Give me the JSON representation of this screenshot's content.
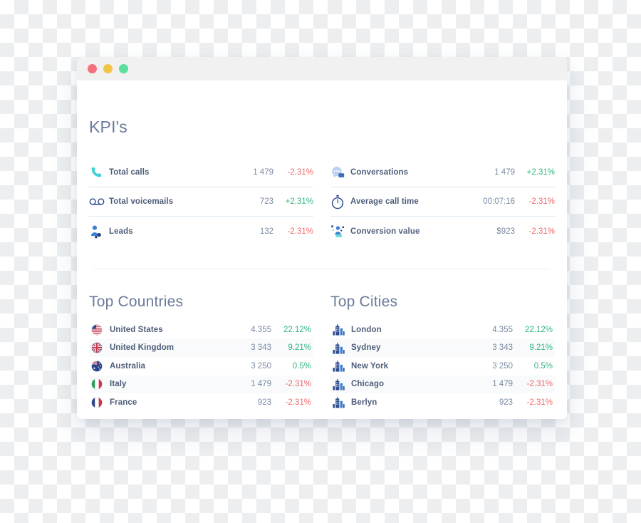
{
  "window": {
    "traffic_lights": [
      {
        "name": "close",
        "color": "#f4707f"
      },
      {
        "name": "minimize",
        "color": "#f3c445"
      },
      {
        "name": "maximize",
        "color": "#5ae09a"
      }
    ]
  },
  "header": {
    "title": "KPI's"
  },
  "kpis": {
    "left": [
      {
        "icon": "phone-icon",
        "label": "Total calls",
        "value": "1 479",
        "delta": "-2.31%",
        "trend": "down"
      },
      {
        "icon": "voicemail-icon",
        "label": "Total voicemails",
        "value": "723",
        "delta": "+2.31%",
        "trend": "up"
      },
      {
        "icon": "leads-icon",
        "label": "Leads",
        "value": "132",
        "delta": "-2.31%",
        "trend": "down"
      }
    ],
    "right": [
      {
        "icon": "chat-bubble-icon",
        "label": "Conversations",
        "value": "1 479",
        "delta": "+2.31%",
        "trend": "up"
      },
      {
        "icon": "stopwatch-icon",
        "label": "Average call time",
        "value": "00:07:16",
        "delta": "-2.31%",
        "trend": "down"
      },
      {
        "icon": "conversion-icon",
        "label": "Conversion value",
        "value": "$923",
        "delta": "-2.31%",
        "trend": "down"
      }
    ]
  },
  "top_countries": {
    "title": "Top Countries",
    "rows": [
      {
        "icon": "flag-us-icon",
        "label": "United States",
        "value": "4.355",
        "delta": "22.12%",
        "trend": "up"
      },
      {
        "icon": "flag-gb-icon",
        "label": "United Kingdom",
        "value": "3 343",
        "delta": "9.21%",
        "trend": "up"
      },
      {
        "icon": "flag-au-icon",
        "label": "Australia",
        "value": "3 250",
        "delta": "0.5%",
        "trend": "up"
      },
      {
        "icon": "flag-it-icon",
        "label": "Italy",
        "value": "1 479",
        "delta": "-2.31%",
        "trend": "down"
      },
      {
        "icon": "flag-fr-icon",
        "label": "France",
        "value": "923",
        "delta": "-2.31%",
        "trend": "down"
      }
    ]
  },
  "top_cities": {
    "title": "Top Cities",
    "rows": [
      {
        "icon": "city-icon",
        "label": "London",
        "value": "4.355",
        "delta": "22.12%",
        "trend": "up"
      },
      {
        "icon": "city-icon",
        "label": "Sydney",
        "value": "3 343",
        "delta": "9.21%",
        "trend": "up"
      },
      {
        "icon": "city-icon",
        "label": "New York",
        "value": "3 250",
        "delta": "0.5%",
        "trend": "up"
      },
      {
        "icon": "city-icon",
        "label": "Chicago",
        "value": "1 479",
        "delta": "-2.31%",
        "trend": "down"
      },
      {
        "icon": "city-icon",
        "label": "Berlyn",
        "value": "923",
        "delta": "-2.31%",
        "trend": "down"
      }
    ]
  },
  "colors": {
    "positive": "#35b67f",
    "negative": "#ef6a6a",
    "heading": "#6a7b99",
    "label": "#4e5d78",
    "value": "#7a8aa3",
    "divider": "#dce8f5",
    "stripe": "#f8fafb"
  }
}
